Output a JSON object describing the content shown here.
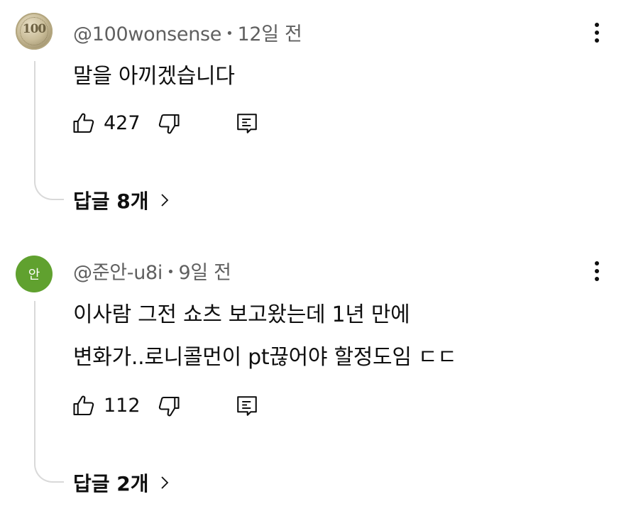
{
  "comments": [
    {
      "avatar_text": "100",
      "author": "@100wonsense",
      "separator": "•",
      "time": "12일 전",
      "lines": [
        "말을 아끼겠습니다"
      ],
      "likes": "427",
      "replies_label": "답글 8개"
    },
    {
      "avatar_text": "안",
      "author": "@준안-u8i",
      "separator": "•",
      "time": "9일 전",
      "lines": [
        "이사람 그전 쇼츠 보고왔는데 1년 만에",
        "변화가..로니콜먼이 pt끊어야 할정도임 ㄷㄷ"
      ],
      "likes": "112",
      "replies_label": "답글 2개"
    }
  ],
  "icons": {
    "like": "thumbs-up-icon",
    "dislike": "thumbs-down-icon",
    "reply": "reply-icon",
    "more": "more-vertical-icon",
    "chevron": "chevron-right-icon"
  },
  "colors": {
    "text": "#0f0f0f",
    "meta": "#606060",
    "avatar_green": "#60a12f",
    "thread_line": "#d9d9d9"
  }
}
